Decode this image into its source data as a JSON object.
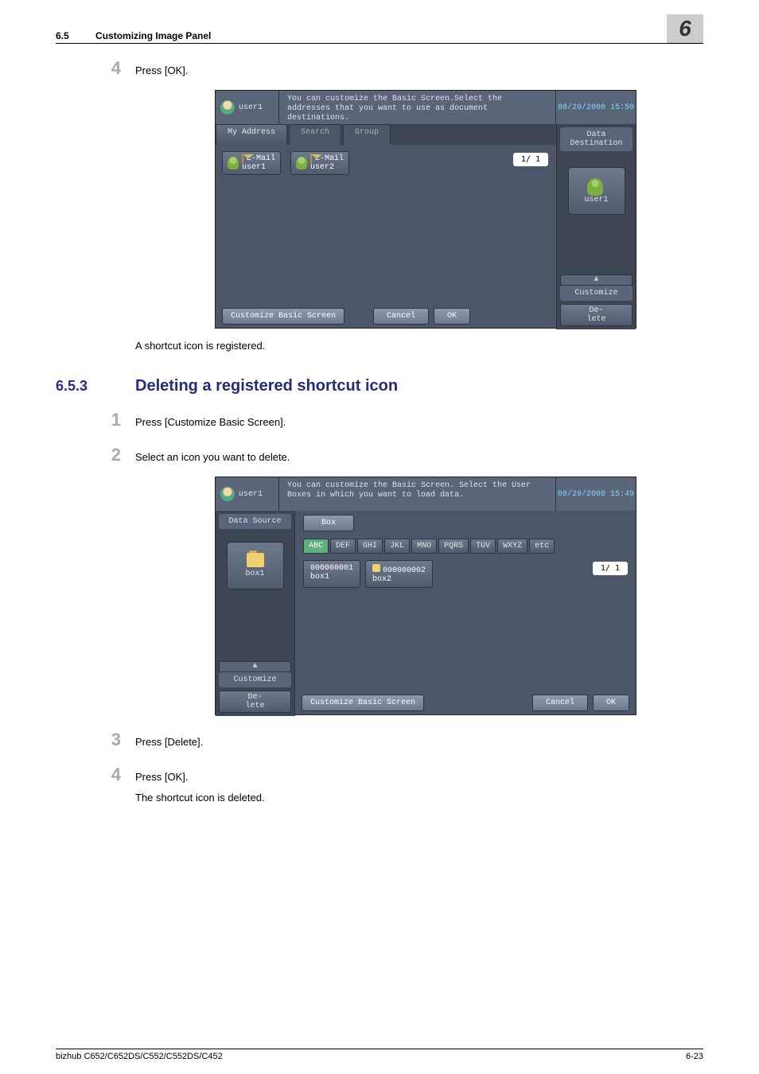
{
  "header": {
    "section_num": "6.5",
    "section_title": "Customizing Image Panel",
    "chapter_num": "6"
  },
  "steps_a": {
    "4": "Press [OK]."
  },
  "caption_a": "A shortcut icon is registered.",
  "section": {
    "num": "6.5.3",
    "title": "Deleting a registered shortcut icon"
  },
  "steps_b": {
    "1": "Press [Customize Basic Screen].",
    "2": "Select an icon you want to delete.",
    "3": "Press [Delete].",
    "4": "Press [OK]."
  },
  "caption_b": "The shortcut icon is deleted.",
  "footer": {
    "model": "bizhub C652/C652DS/C552/C552DS/C452",
    "page": "6-23"
  },
  "ss1": {
    "user": "user1",
    "message": "You can customize the Basic Screen.Select the addresses that you want to use as document destinations.",
    "datetime": "08/29/2008  15:50",
    "tabs": {
      "my_address": "My Address",
      "search": "Search",
      "group": "Group"
    },
    "items": {
      "a": {
        "type": "E-Mail",
        "name": "user1"
      },
      "b": {
        "type": "E-Mail",
        "name": "user2"
      }
    },
    "page_indicator": "1/  1",
    "data_dest": "Data Destination",
    "shortcut": "user1",
    "up": "▲",
    "customize": "Customize",
    "delete": "De-\nlete",
    "cbs": "Customize Basic Screen",
    "cancel": "Cancel",
    "ok": "OK"
  },
  "ss2": {
    "user": "user1",
    "message": "You can customize the Basic Screen. Select the User Boxes in which you want to load data.",
    "datetime": "08/29/2008  15:49",
    "data_source": "Data Source",
    "shortcut": "box1",
    "up": "▲",
    "customize": "Customize",
    "delete": "De-\nlete",
    "category": "Box",
    "letters": {
      "abc": "ABC",
      "def": "DEF",
      "ghi": "GHI",
      "jkl": "JKL",
      "mno": "MNO",
      "pqrs": "PQRS",
      "tuv": "TUV",
      "wxyz": "WXYZ",
      "etc": "etc"
    },
    "boxes": {
      "a": {
        "id": "000000001",
        "name": "box1"
      },
      "b": {
        "id": "000000002",
        "name": "box2"
      }
    },
    "page_indicator": "1/  1",
    "cbs": "Customize Basic Screen",
    "cancel": "Cancel",
    "ok": "OK"
  }
}
